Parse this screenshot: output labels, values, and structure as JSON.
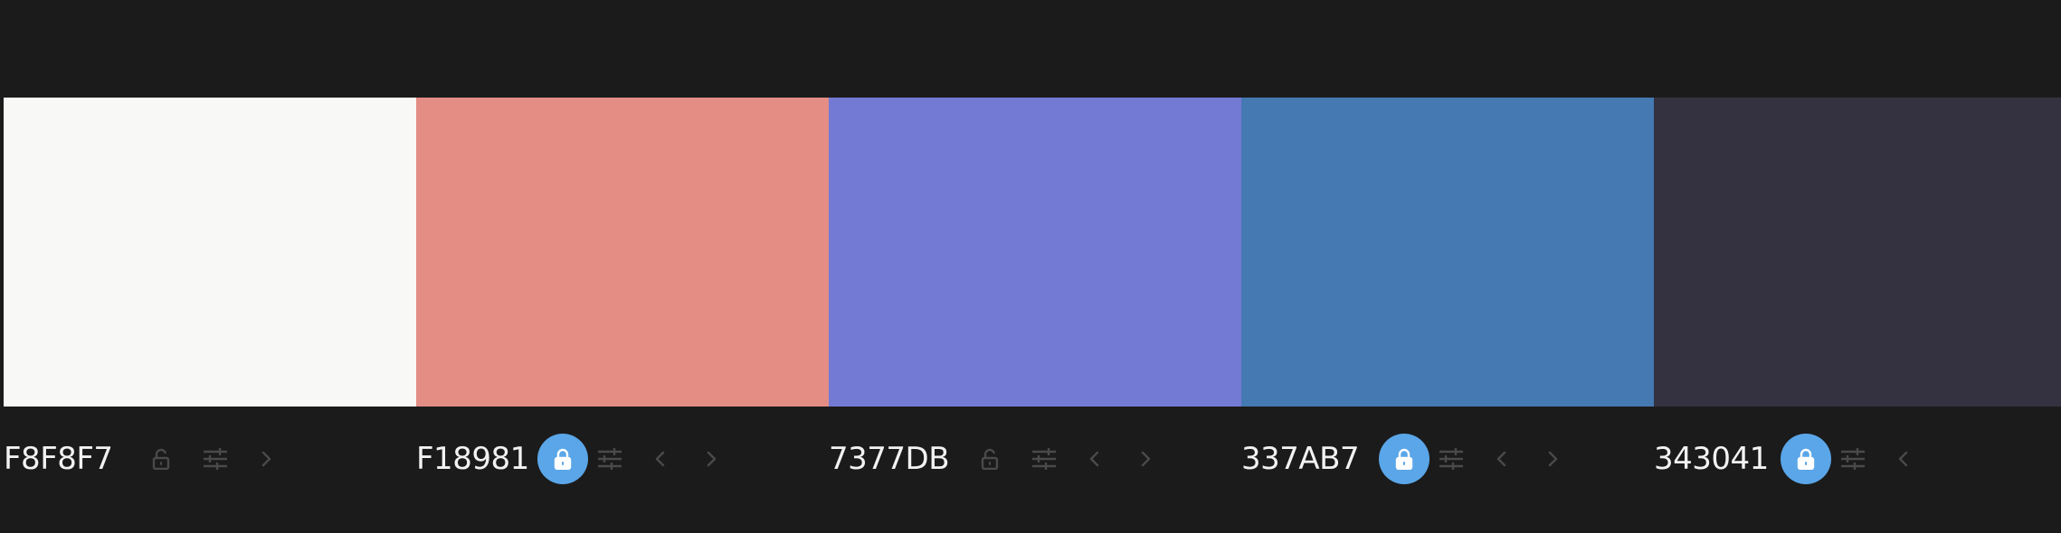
{
  "palette": {
    "swatches": [
      {
        "hex": "F8F8F7",
        "color": "#F8F8F7",
        "locked": false,
        "has_prev": false,
        "has_next": true
      },
      {
        "hex": "F18981",
        "color": "#E38D84",
        "locked": true,
        "has_prev": true,
        "has_next": true
      },
      {
        "hex": "7377DB",
        "color": "#737AD3",
        "locked": false,
        "has_prev": true,
        "has_next": true
      },
      {
        "hex": "337AB7",
        "color": "#4479B2",
        "locked": true,
        "has_prev": true,
        "has_next": true
      },
      {
        "hex": "343041",
        "color": "#343241",
        "locked": true,
        "has_prev": true,
        "has_next": false
      }
    ],
    "icons": {
      "lock": "lock-icon",
      "adjust": "sliders-icon",
      "prev": "chevron-left-icon",
      "next": "chevron-right-icon"
    },
    "colors": {
      "background": "#1B1B1B",
      "lock_active": "#5AA6E8",
      "icon_muted": "#4A4A4A",
      "hex_text": "#F2F2F2"
    }
  }
}
